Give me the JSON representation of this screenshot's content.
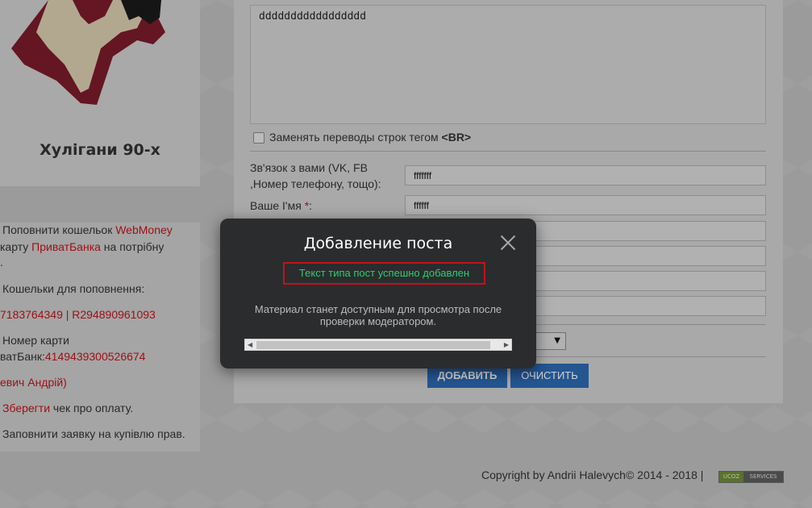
{
  "site": {
    "title": "Хулігани 90-х"
  },
  "left_list": {
    "l1_prefix": "Поповнити кошельок ",
    "l1_link": "WebMoney",
    "l2_prefix": "карту ",
    "l2_link": "ПриватБанка",
    "l2_suffix": " на потрібну",
    "l3": ".",
    "l4": "Кошельки для поповнення:",
    "l5": "7183764349 | R294890961093",
    "l6": "Номер карти",
    "l7_prefix": "ватБанк:",
    "l7_link": "4149439300526674",
    "l8": "евич Андрій)",
    "l9_link": "Зберегти",
    "l9_suffix": " чек про оплату.",
    "l10": "Заповнити заявку на купівлю прав."
  },
  "form": {
    "content_value": "ddddddddddddddddd",
    "replace_br_label": "Заменять переводы строк тегом ",
    "replace_br_tag": "<BR>",
    "contact_label_line1": "Зв'язок з вами (VK, FB",
    "contact_label_line2": ",Номер телефону, тощо):",
    "contact_value": "fffffff",
    "name_label": "Ваше І'мя ",
    "required_mark": "*",
    "name_suffix": ":",
    "name_value": "ffffff",
    "add_button": "ДОБАВИТЬ",
    "clear_button": "ОЧИСТИТЬ"
  },
  "modal": {
    "title": "Добавление поста",
    "success": "Текст типа пост успешно добавлен",
    "message": "Материал станет доступным для просмотра после проверки модератором."
  },
  "footer": {
    "copyright": "Copyright by Andrii Halevych© 2014 - 2018 |",
    "badge_left": "UCOZ",
    "badge_right": "SERVICES"
  },
  "colors": {
    "accent_red": "#c0141c",
    "button_blue": "#2d6ab2",
    "success_green": "#2ecc71",
    "modal_bg": "#2b2c2e"
  }
}
